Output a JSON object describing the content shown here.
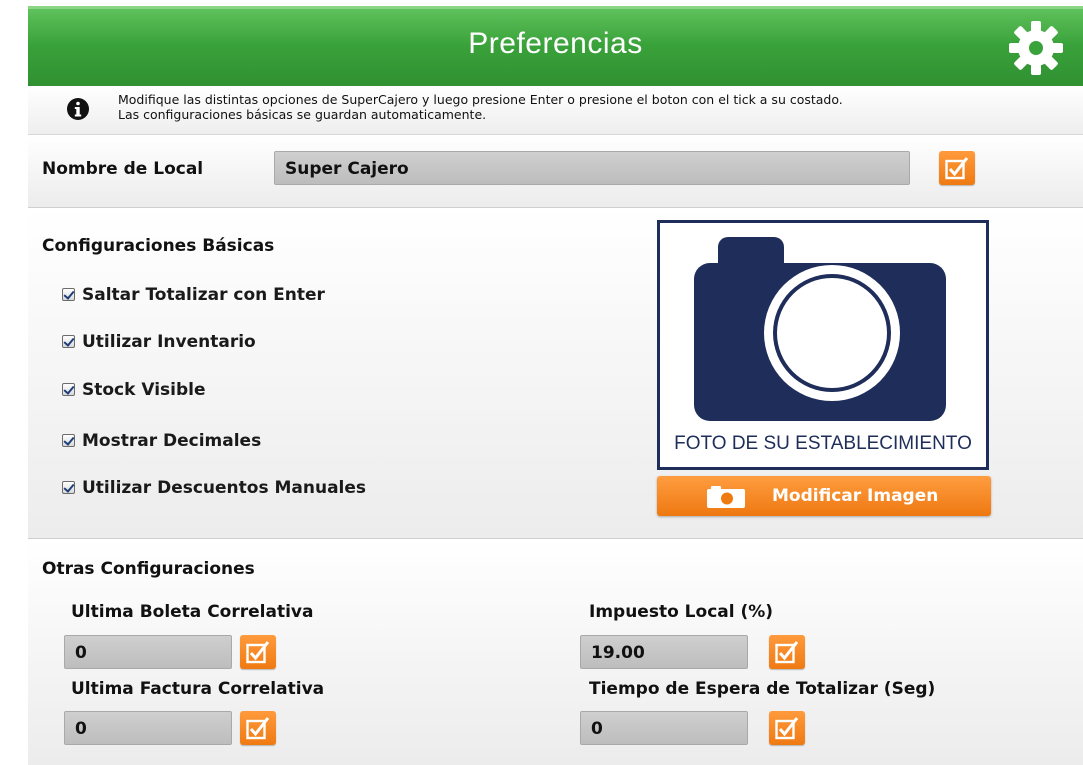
{
  "header": {
    "title": "Preferencias",
    "settings_icon": "gear-icon"
  },
  "info": {
    "icon": "info-icon",
    "line1": "Modifique las distintas opciones de SuperCajero y luego presione Enter o presione el boton con el tick a su costado.",
    "line2": "Las configuraciones básicas se guardan automaticamente."
  },
  "store_name": {
    "label": "Nombre de Local",
    "value": "Super Cajero"
  },
  "basic": {
    "title": "Configuraciones Básicas",
    "options": [
      {
        "label": "Saltar Totalizar con Enter",
        "checked": true
      },
      {
        "label": "Utilizar Inventario",
        "checked": true
      },
      {
        "label": "Stock Visible",
        "checked": true
      },
      {
        "label": "Mostrar Decimales",
        "checked": true
      },
      {
        "label": "Utilizar Descuentos Manuales",
        "checked": true
      }
    ]
  },
  "photo": {
    "caption": "FOTO DE SU ESTABLECIMIENTO",
    "button_label": "Modificar Imagen"
  },
  "other": {
    "title": "Otras Configuraciones",
    "boleta_label": "Ultima Boleta Correlativa",
    "boleta_value": "0",
    "impuesto_label": "Impuesto Local (%)",
    "impuesto_value": "19.00",
    "factura_label": "Ultima Factura Correlativa",
    "factura_value": "0",
    "espera_label": "Tiempo de Espera de Totalizar (Seg)",
    "espera_value": "0"
  },
  "colors": {
    "header_green": "#3aa23a",
    "accent_orange": "#f28a22",
    "photo_navy": "#1f2d5a"
  }
}
